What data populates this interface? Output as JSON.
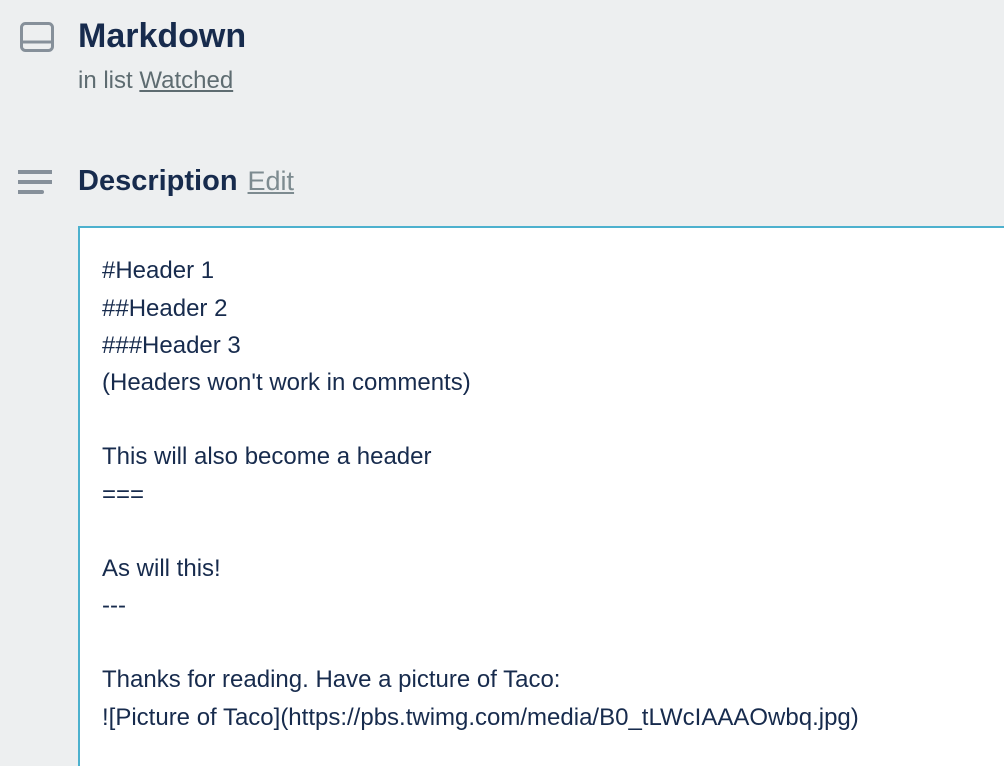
{
  "card": {
    "title": "Markdown",
    "list_prefix": "in list ",
    "list_name": "Watched"
  },
  "description": {
    "label": "Description",
    "edit_label": "Edit",
    "content": "#Header 1\n##Header 2\n###Header 3\n(Headers won't work in comments)\n\nThis will also become a header\n===\n\nAs will this!\n---\n\nThanks for reading. Have a picture of Taco:\n![Picture of Taco](https://pbs.twimg.com/media/B0_tLWcIAAAOwbq.jpg)"
  }
}
